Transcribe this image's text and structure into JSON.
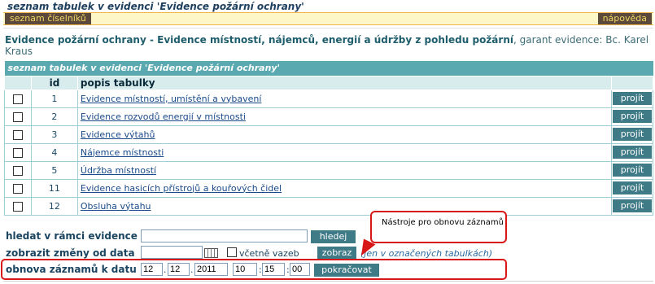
{
  "header": {
    "title": "seznam tabulek v evidenci 'Evidence požární ochrany'",
    "seznam_label": "seznam číselníků",
    "help_label": "nápověda"
  },
  "evidence": {
    "title_bold": "Evidence požární ochrany - Evidence místností, nájemců, energií a údržby z pohledu požární",
    "garant": ", garant evidence: Bc. Karel Kraus"
  },
  "table": {
    "caption": "seznam tabulek v evidenci 'Evidence požární ochrany'",
    "col_id": "id",
    "col_popis": "popis tabulky",
    "btn_label": "projít",
    "rows": [
      {
        "id": "1",
        "popis": "Evidence místností, umístění a vybavení"
      },
      {
        "id": "2",
        "popis": "Evidence rozvodů energií v místnosti"
      },
      {
        "id": "3",
        "popis": "Evidence výtahů"
      },
      {
        "id": "4",
        "popis": "Nájemce místnosti"
      },
      {
        "id": "5",
        "popis": "Údržba místností"
      },
      {
        "id": "11",
        "popis": "Evidence hasicích přístrojů a kouřových čidel"
      },
      {
        "id": "12",
        "popis": "Obsluha výtahu"
      }
    ]
  },
  "search": {
    "label": "hledat v rámci evidence",
    "value": "",
    "button": "hledej"
  },
  "changes": {
    "label": "zobrazit změny od data",
    "value": "",
    "checkbox_label": "včetně vazeb",
    "button": "zobraz",
    "hint": "(jen v označených tabulkách)"
  },
  "restore": {
    "label": "obnova záznamů k datu",
    "day": "12",
    "month": "12",
    "year": "2011",
    "hour": "10",
    "minute": "15",
    "second": "00",
    "button": "pokračovat"
  },
  "callout": {
    "text": "Nástroje pro obnovu záznamů"
  },
  "colors": {
    "accent": "#3f7a87",
    "header_teal": "#5aa8b0",
    "highlight_red": "#d81818"
  }
}
